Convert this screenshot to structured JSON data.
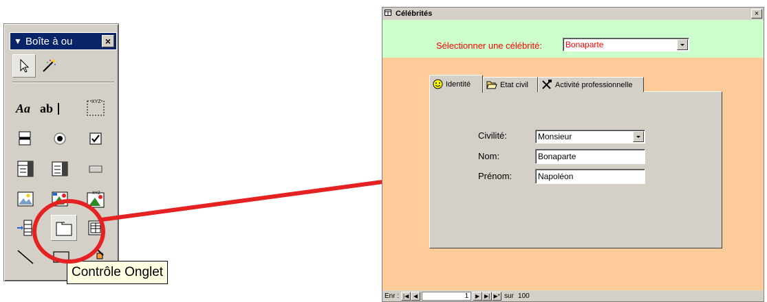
{
  "toolbox": {
    "title": "Boîte à ou",
    "close": "×",
    "arrow": "▼",
    "tools": [
      "pointer-tool",
      "wizard-tool",
      "label-tool",
      "textbox-tool",
      "option-group-tool",
      "toggle-button-tool",
      "option-button-tool",
      "checkbox-tool",
      "combobox-tool",
      "listbox-tool",
      "command-button-tool",
      "image-tool",
      "unbound-object-frame-tool",
      "bound-object-frame-tool",
      "page-break-tool",
      "tab-control-tool",
      "subform-tool",
      "line-tool",
      "rectangle-tool",
      "more-controls-tool"
    ],
    "tooltip": "Contrôle Onglet"
  },
  "form": {
    "title": "Célébrités",
    "close": "×",
    "select_label": "Sélectionner une célébrité:",
    "select_value": "Bonaparte",
    "tabs": [
      {
        "label": "Identité",
        "icon": "smiley-icon"
      },
      {
        "label": "Etat civil",
        "icon": "folder-open-icon"
      },
      {
        "label": "Activité professionnelle",
        "icon": "tools-icon"
      }
    ],
    "fields": {
      "civilite_label": "Civilité:",
      "civilite_value": "Monsieur",
      "nom_label": "Nom:",
      "nom_value": "Bonaparte",
      "prenom_label": "Prénom:",
      "prenom_value": "Napoléon"
    },
    "nav": {
      "label": "Enr :",
      "first": "|◀",
      "prev": "◀",
      "current": "1",
      "next": "▶",
      "last": "▶|",
      "new": "▶*",
      "of_label": "sur",
      "total": "100"
    }
  },
  "colors": {
    "annotation": "#e52222",
    "form_header": "#ccffcc",
    "form_detail": "#ffcc99",
    "label_red": "#ff0000"
  }
}
